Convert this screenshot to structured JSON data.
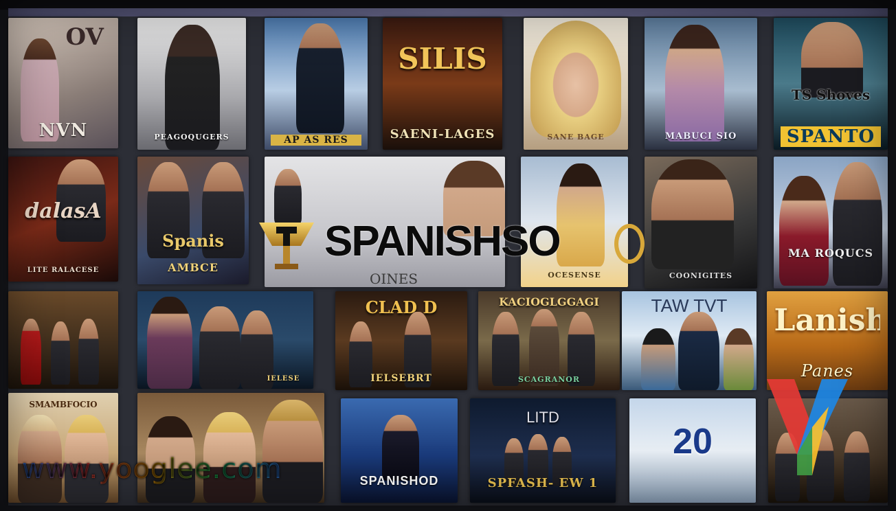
{
  "banner": {
    "title": "SPANISHSO",
    "sub": "OINES"
  },
  "watermark": {
    "text": "www.yooglee.com"
  },
  "colors": {
    "gold": "#d8a83a",
    "wall": "#2c2e36"
  },
  "tiles": [
    {
      "head": "OV",
      "cap": "NVN"
    },
    {
      "head": "",
      "cap": "PEAGOQUGERS"
    },
    {
      "head": "",
      "cap": "AP AS RES"
    },
    {
      "head": "SILIS",
      "cap": "SAENI-LAGES"
    },
    {
      "head": "",
      "cap": "SANE BAGE"
    },
    {
      "head": "",
      "cap": "MABUCI SIO"
    },
    {
      "head": "TS Shoves",
      "cap": "SPANTO"
    },
    {
      "head": "dalasA",
      "cap": "LITE RALACESE"
    },
    {
      "head": "Spanis",
      "cap": "AMBCE"
    },
    {
      "head": "",
      "cap": ""
    },
    {
      "head": "",
      "cap": "OCESENSE"
    },
    {
      "head": "",
      "cap": "COONIGITES"
    },
    {
      "head": "",
      "cap": "MA ROQUCS"
    },
    {
      "head": "",
      "cap": ""
    },
    {
      "head": "",
      "cap": "IELESE"
    },
    {
      "head": "CLAD D",
      "cap": "IELSEBRT"
    },
    {
      "head": "KACIOGLGGAGI",
      "cap": "SCAGRANOR"
    },
    {
      "head": "TAW TVT",
      "cap": ""
    },
    {
      "head": "Lanish",
      "cap": "Panes"
    },
    {
      "head": "SMAMBFOCIO",
      "cap": ""
    },
    {
      "head": "",
      "cap": ""
    },
    {
      "head": "",
      "cap": "SPANISHOD"
    },
    {
      "head": "LITD",
      "cap": "SPFASH- EW 1"
    },
    {
      "head": "20",
      "cap": ""
    },
    {
      "head": "",
      "cap": ""
    }
  ]
}
